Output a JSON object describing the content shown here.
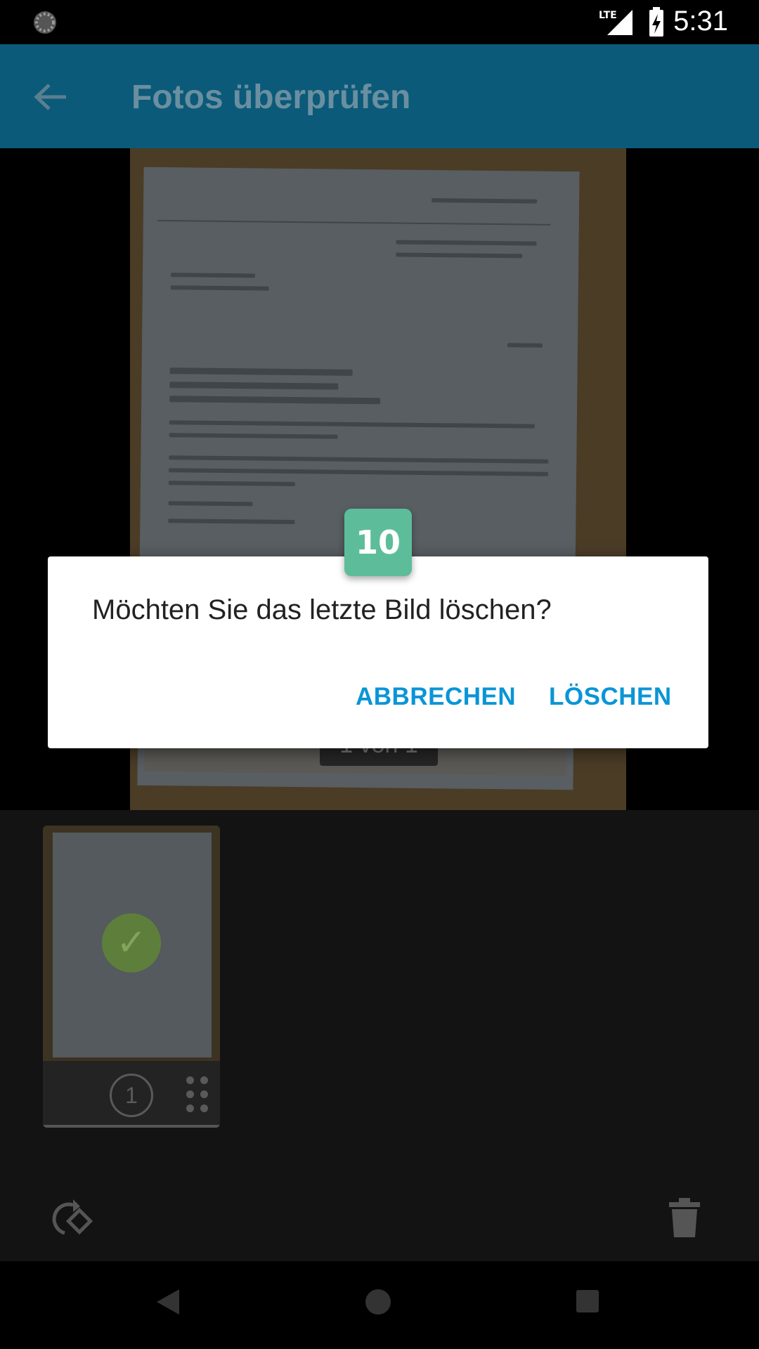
{
  "status_bar": {
    "time": "5:31",
    "network": "LTE"
  },
  "app_bar": {
    "title": "Fotos überprüfen"
  },
  "viewer": {
    "page_indicator": "1 von 1"
  },
  "thumbnail": {
    "page_number": "1"
  },
  "dialog": {
    "message": "Möchten Sie das letzte Bild löschen?",
    "cancel_label": "ABBRECHEN",
    "delete_label": "LÖSCHEN"
  },
  "badge": {
    "count": "10"
  },
  "colors": {
    "accent": "#0a95d6",
    "app_bar": "#0b5a79",
    "badge": "#5dbd9b",
    "check": "#7fa65b"
  }
}
